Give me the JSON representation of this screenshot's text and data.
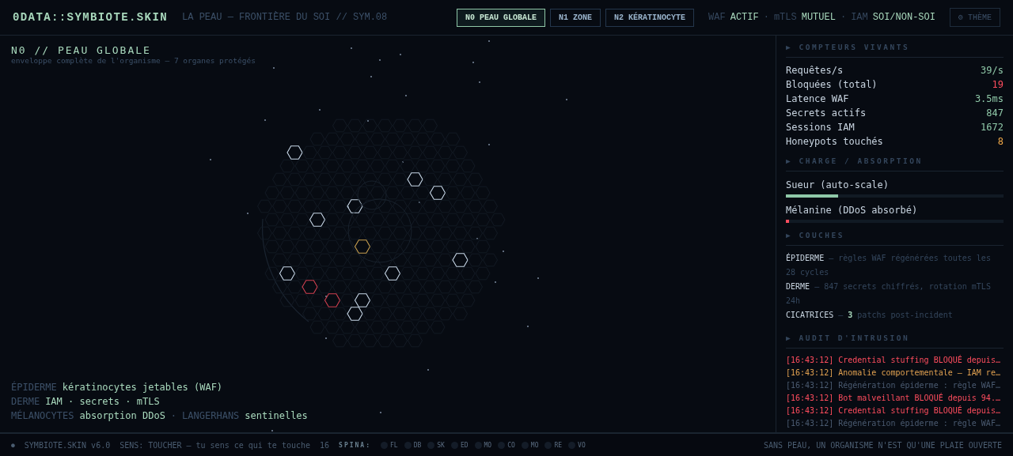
{
  "header": {
    "logo": "0DATA::SYMBIOTE.SKIN",
    "subtitle": "LA PEAU — FRONTIÈRE DU SOI // SYM.08",
    "tabs": [
      {
        "label": "N0 PEAU GLOBALE",
        "selected": true
      },
      {
        "label": "N1 ZONE",
        "selected": false
      },
      {
        "label": "N2 KÉRATINOCYTE",
        "selected": false
      }
    ],
    "statuses": [
      {
        "label": "WAF",
        "value": "ACTIF"
      },
      {
        "label": "mTLS",
        "value": "MUTUEL"
      },
      {
        "label": "IAM",
        "value": "SOI/NON-SOI"
      }
    ],
    "separator": "·",
    "theme_button": "⚙ THÈME"
  },
  "canvas": {
    "title": "N0 // PEAU GLOBALE",
    "subtitle": "enveloppe complète de l'organisme — 7 organes protégés",
    "legend": [
      [
        {
          "label": "ÉPIDERME",
          "value": "kératinocytes jetables (WAF)"
        }
      ],
      [
        {
          "label": "DERME",
          "value": "IAM · secrets · mTLS"
        }
      ],
      [
        {
          "label": "MÉLANOCYTES",
          "value": "absorption DDoS"
        },
        {
          "label": "LANGERHANS",
          "value": "sentinelles"
        }
      ]
    ],
    "legend_separator": "·"
  },
  "sidebar": {
    "counters_title": "▶ COMPTEURS VIVANTS",
    "counters": [
      {
        "label": "Requêtes/s",
        "value": "39/s",
        "color": "#8fc8a8"
      },
      {
        "label": "Bloquées (total)",
        "value": "19",
        "color": "#ff4d5e"
      },
      {
        "label": "Latence WAF",
        "value": "3.5ms",
        "color": "#8fc8a8"
      },
      {
        "label": "Secrets actifs",
        "value": "847",
        "color": "#8fc8a8"
      },
      {
        "label": "Sessions IAM",
        "value": "1672",
        "color": "#8fc8a8"
      },
      {
        "label": "Honeypots touchés",
        "value": "8",
        "color": "#f0a848"
      }
    ],
    "charge_title": "▶ CHARGE / ABSORPTION",
    "gauges": [
      {
        "label": "Sueur (auto-scale)",
        "level": 0.24,
        "color": "#8fc8a8"
      },
      {
        "label": "Mélanine (DDoS absorbé)",
        "level": 0.006,
        "color": "#ff4d5e"
      }
    ],
    "layers_title": "▶ COUCHES",
    "layers": [
      {
        "name": "ÉPIDERME",
        "text": "— règles WAF régénérées toutes les 28 cycles"
      },
      {
        "name": "DERME",
        "text": "— 847 secrets chiffrés, rotation mTLS 24h"
      },
      {
        "name": "CICATRICES",
        "text": "— **3** patchs post-incident"
      }
    ],
    "audit_title": "▶ AUDIT D'INTRUSION",
    "audit": [
      {
        "time": "[16:43:12]",
        "text": "Credential stuffing BLOQUÉ depuis…",
        "color": "#ff4d5e"
      },
      {
        "time": "[16:43:12]",
        "text": "Anomalie comportementale — IAM re…",
        "color": "#e0a050"
      },
      {
        "time": "[16:43:12]",
        "text": "Régénération épiderme : règle WAF…",
        "color": "#4a5a70"
      },
      {
        "time": "[16:43:12]",
        "text": "Bot malveillant BLOQUÉ depuis 94.…",
        "color": "#ff4d5e"
      },
      {
        "time": "[16:43:12]",
        "text": "Credential stuffing BLOQUÉ depuis…",
        "color": "#ff4d5e"
      },
      {
        "time": "[16:43:12]",
        "text": "Régénération épiderme : règle WAF…",
        "color": "#4a5a70"
      }
    ]
  },
  "footer": {
    "dot": "●",
    "version": "SYMBIOTE.SKIN v6.0",
    "sense": "SENS: TOUCHER — tu sens ce qui te touche",
    "count": "16",
    "spina_label": "SPINA:",
    "spina": [
      {
        "label": "FL"
      },
      {
        "label": "DB"
      },
      {
        "label": "SK"
      },
      {
        "label": "ED"
      },
      {
        "label": "MO"
      },
      {
        "label": "CO"
      },
      {
        "label": "MO"
      },
      {
        "label": "RE"
      },
      {
        "label": "VO"
      }
    ],
    "motto": "SANS PEAU, UN ORGANISME N'EST QU'UNE PLAIE OUVERTE"
  }
}
